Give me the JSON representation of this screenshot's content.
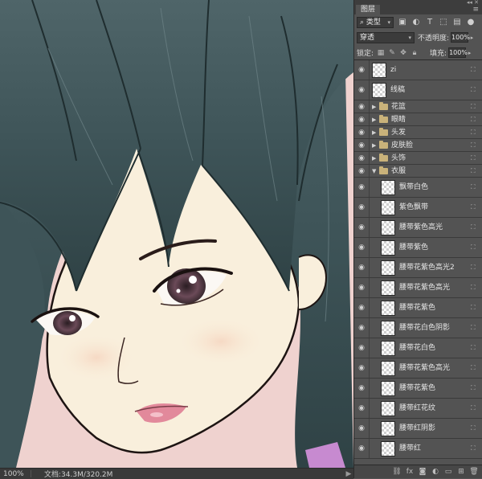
{
  "canvas": {
    "artwork": "anime-style portrait of a girl with dark teal hair"
  },
  "status": {
    "zoom": "100%",
    "doc_info": "文档:34.3M/320.2M",
    "arrow": "▶"
  },
  "panel": {
    "tab_label": "图层",
    "menu_icon": "≡",
    "filter_kind": "类型",
    "blend_mode": "穿透",
    "opacity_label": "不透明度:",
    "opacity_value": "100%",
    "lock_label": "锁定:",
    "fill_label": "填充:",
    "fill_value": "100%"
  },
  "layers": [
    {
      "name": "zi",
      "kind": "layer"
    },
    {
      "name": "线稿",
      "kind": "layer"
    },
    {
      "name": "花篮",
      "kind": "group",
      "expanded": false
    },
    {
      "name": "眼睛",
      "kind": "group",
      "expanded": false
    },
    {
      "name": "头发",
      "kind": "group",
      "expanded": false
    },
    {
      "name": "皮肤脸",
      "kind": "group",
      "expanded": false
    },
    {
      "name": "头饰",
      "kind": "group",
      "expanded": false
    },
    {
      "name": "衣服",
      "kind": "group",
      "expanded": true
    },
    {
      "name": "飘带白色",
      "kind": "child"
    },
    {
      "name": "紫色飘带",
      "kind": "child"
    },
    {
      "name": "腰带紫色高光",
      "kind": "child"
    },
    {
      "name": "腰带紫色",
      "kind": "child"
    },
    {
      "name": "腰带花紫色高光2",
      "kind": "child"
    },
    {
      "name": "腰带花紫色高光",
      "kind": "child"
    },
    {
      "name": "腰带花紫色",
      "kind": "child"
    },
    {
      "name": "腰带花白色阴影",
      "kind": "child"
    },
    {
      "name": "腰带花白色",
      "kind": "child"
    },
    {
      "name": "腰带花紫色高光",
      "kind": "child"
    },
    {
      "name": "腰带花紫色",
      "kind": "child"
    },
    {
      "name": "腰带红花纹",
      "kind": "child"
    },
    {
      "name": "腰带红阴影",
      "kind": "child"
    },
    {
      "name": "腰带红",
      "kind": "child"
    }
  ],
  "colors": {
    "canvas_bg": "#efd2cf",
    "hair": "#3c5357",
    "skin": "#f9efdc",
    "lips": "#e2899b",
    "iris": "#5a3d4a",
    "panel_bg": "#535353"
  },
  "icons": {
    "eye": "eye-icon",
    "lock": "lock-icon",
    "folder": "folder-icon",
    "link": "link-icon",
    "fx": "fx-icon",
    "mask": "mask-icon",
    "adjust": "adjustment-icon",
    "new_group": "new-group-icon",
    "new_layer": "new-layer-icon",
    "trash": "trash-icon"
  }
}
